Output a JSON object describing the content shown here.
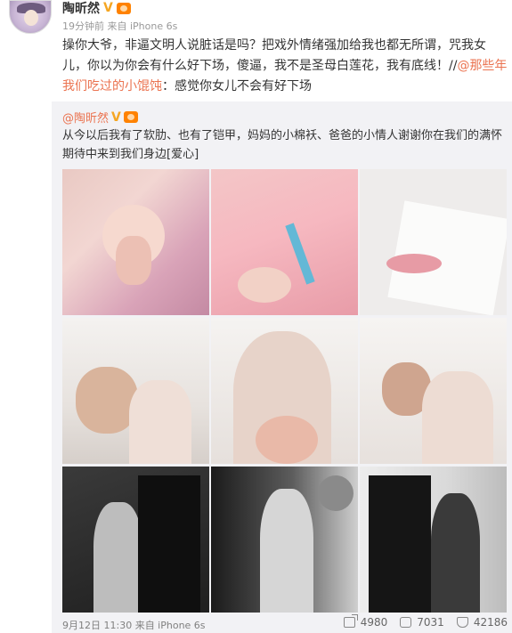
{
  "author": {
    "name": "陶昕然",
    "verified_mark": "V",
    "meta": "19分钟前 来自 iPhone 6s"
  },
  "post": {
    "text_main": "操你大爷，非逼文明人说脏话是吗？把戏外情绪强加给我也都无所谓，咒我女儿，你以为你会有什么好下场，傻逼，我不是圣母白莲花，我有底线！//",
    "link_text": "@那些年我们吃过的小馄饨",
    "text_tail": "：感觉你女儿不会有好下场"
  },
  "repost": {
    "author_name": "@陶昕然",
    "verified_mark": "V",
    "text": "从今以后我有了软肋、也有了铠甲，妈妈的小棉袄、爸爸的小情人谢谢你在我们的满怀期待中来到我们身边[爱心]",
    "footer_time": "9月12日 11:30 来自 iPhone 6s",
    "stats": {
      "reposts": "4980",
      "comments": "7031",
      "likes": "42186"
    }
  },
  "photos": [
    "photo-1",
    "photo-2",
    "photo-3",
    "photo-4",
    "photo-5",
    "photo-6",
    "photo-7",
    "photo-8",
    "photo-9"
  ]
}
